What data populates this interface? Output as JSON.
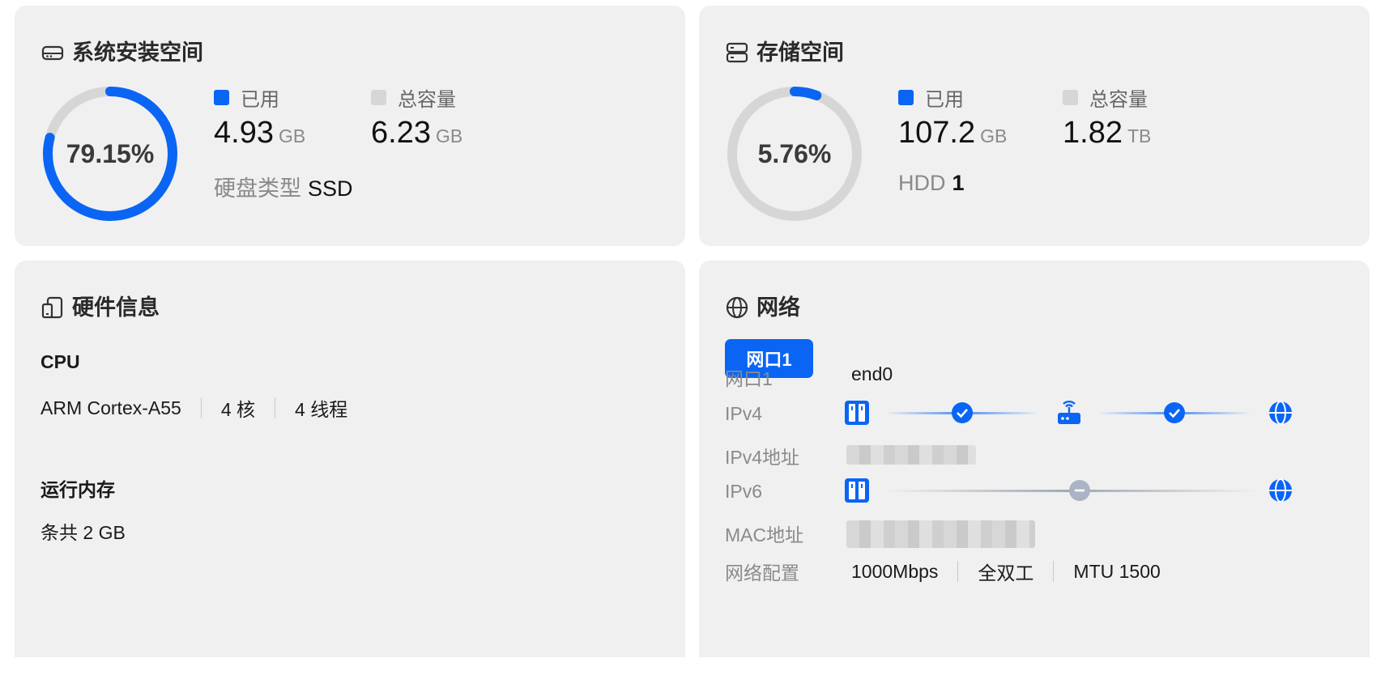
{
  "system_install": {
    "title": "系统安装空间",
    "icon": "hard-drive-icon",
    "percent_text": "79.15%",
    "percent": 79.15,
    "used_label": "已用",
    "used_value": "4.93",
    "used_unit": "GB",
    "total_label": "总容量",
    "total_value": "6.23",
    "total_unit": "GB",
    "disk_type_label": "硬盘类型",
    "disk_type_value": "SSD"
  },
  "storage": {
    "title": "存储空间",
    "icon": "server-icon",
    "percent_text": "5.76%",
    "percent": 5.76,
    "used_label": "已用",
    "used_value": "107.2",
    "used_unit": "GB",
    "total_label": "总容量",
    "total_value": "1.82",
    "total_unit": "TB",
    "disk_type_label": "HDD",
    "disk_type_value": "1"
  },
  "hardware": {
    "title": "硬件信息",
    "icon": "device-icon",
    "cpu_label": "CPU",
    "cpu_model": "ARM Cortex-A55",
    "cpu_cores": "4 核",
    "cpu_threads": "4 线程",
    "memory_label": "运行内存",
    "memory_value": "条共 2 GB"
  },
  "network": {
    "title": "网络",
    "icon": "globe-icon",
    "tab_label": "网口1",
    "port_label": "网口1",
    "port_value": "end0",
    "ipv4_label": "IPv4",
    "ipv4_addr_label": "IPv4地址",
    "ipv6_label": "IPv6",
    "mac_label": "MAC地址",
    "config_label": "网络配置",
    "speed": "1000Mbps",
    "duplex": "全双工",
    "mtu": "MTU 1500"
  },
  "colors": {
    "accent": "#0a65f4",
    "track": "#d6d6d6",
    "legend_total": "#d6d6d6",
    "card_bg": "#f0f0f0",
    "inactive": "#aab4c4"
  }
}
